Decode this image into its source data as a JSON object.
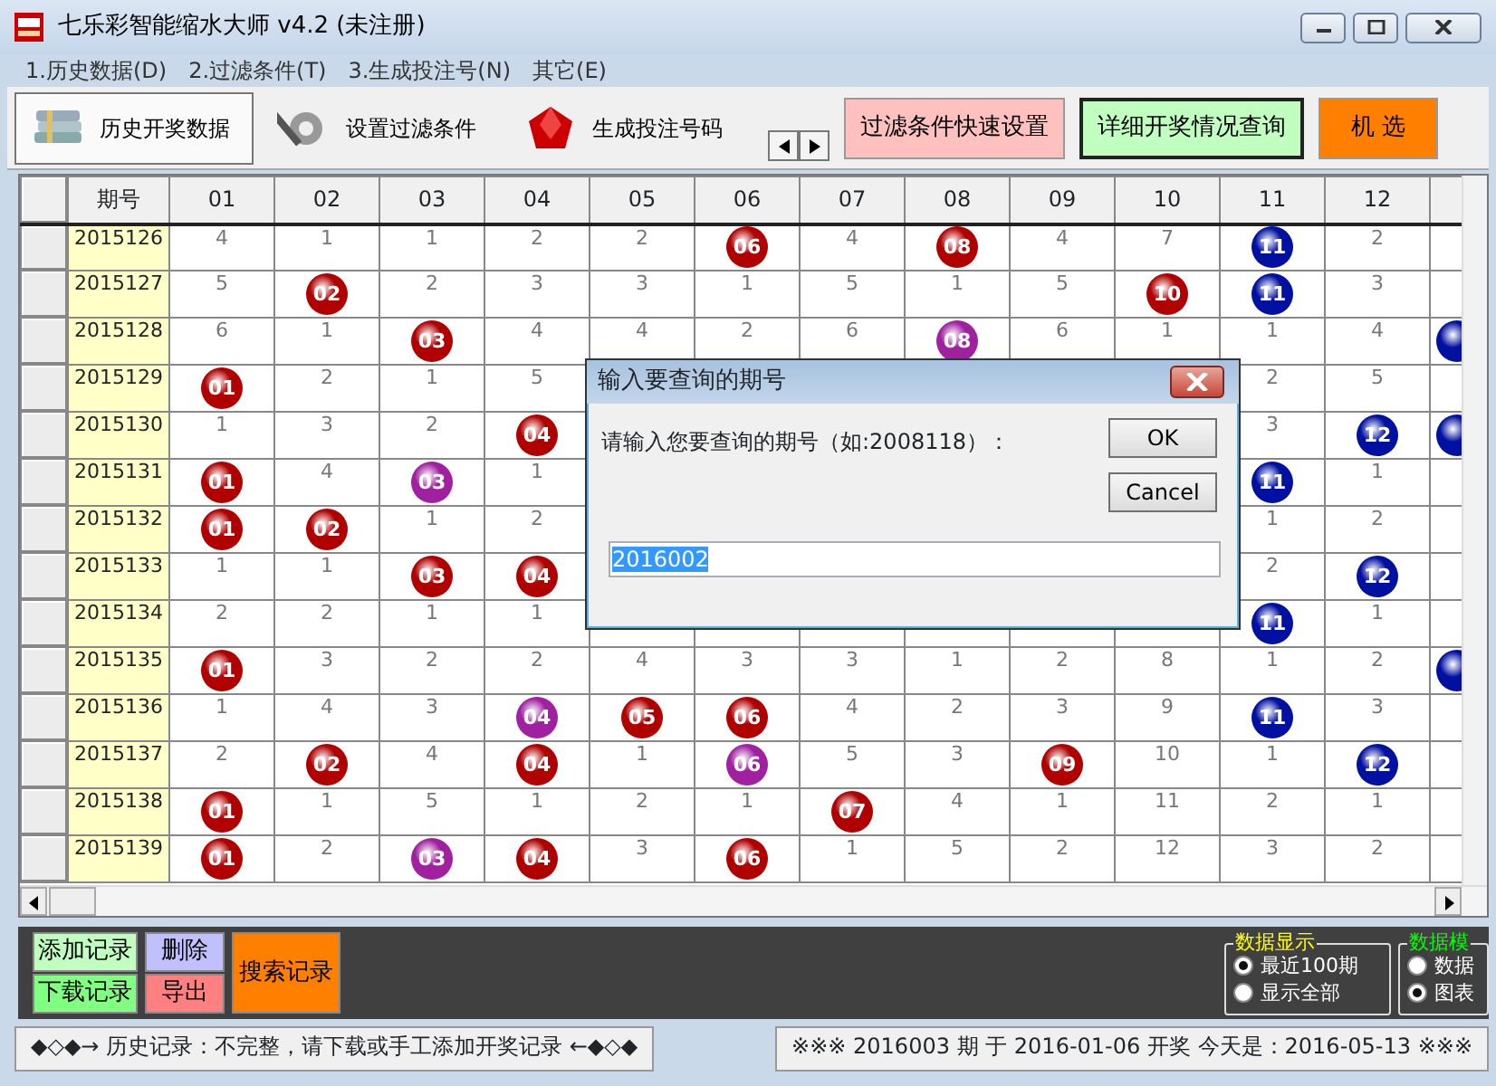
{
  "window": {
    "title": "七乐彩智能缩水大师 v4.2  (未注册)"
  },
  "menu": [
    {
      "label": "1.历史数据(D)"
    },
    {
      "label": "2.过滤条件(T)"
    },
    {
      "label": "3.生成投注号(N)"
    },
    {
      "label": "其它(E)"
    }
  ],
  "toolbar": {
    "tabs": [
      {
        "label": "历史开奖数据",
        "selected": true
      },
      {
        "label": "设置过滤条件",
        "selected": false
      },
      {
        "label": "生成投注号码",
        "selected": false
      }
    ],
    "buttons": [
      {
        "label": "过滤条件快速设置",
        "color": "#ffc0c0"
      },
      {
        "label": "详细开奖情况查询",
        "color": "#c0ffc0"
      },
      {
        "label": "机 选",
        "color": "#ff8000"
      }
    ]
  },
  "grid": {
    "columns": [
      "期号",
      "01",
      "02",
      "03",
      "04",
      "05",
      "06",
      "07",
      "08",
      "09",
      "10",
      "11",
      "12"
    ],
    "rows": [
      {
        "cells": [
          {
            "kind": "period",
            "text": "2015126"
          },
          {
            "kind": "miss",
            "text": "4"
          },
          {
            "kind": "miss",
            "text": "1"
          },
          {
            "kind": "miss",
            "text": "1"
          },
          {
            "kind": "miss",
            "text": "2"
          },
          {
            "kind": "miss",
            "text": "2"
          },
          {
            "kind": "ball",
            "text": "06",
            "color": "#b00000"
          },
          {
            "kind": "miss",
            "text": "4"
          },
          {
            "kind": "ball",
            "text": "08",
            "color": "#b00000"
          },
          {
            "kind": "miss",
            "text": "4"
          },
          {
            "kind": "miss",
            "text": "7"
          },
          {
            "kind": "ball",
            "text": "11",
            "color": "#0010a0"
          },
          {
            "kind": "miss",
            "text": "2"
          },
          null
        ]
      },
      {
        "cells": [
          {
            "kind": "period",
            "text": "2015127"
          },
          {
            "kind": "miss",
            "text": "5"
          },
          {
            "kind": "ball",
            "text": "02",
            "color": "#b00000"
          },
          {
            "kind": "miss",
            "text": "2"
          },
          {
            "kind": "miss",
            "text": "3"
          },
          {
            "kind": "miss",
            "text": "3"
          },
          {
            "kind": "miss",
            "text": "1"
          },
          {
            "kind": "miss",
            "text": "5"
          },
          {
            "kind": "miss",
            "text": "1"
          },
          {
            "kind": "miss",
            "text": "5"
          },
          {
            "kind": "ball",
            "text": "10",
            "color": "#b00000"
          },
          {
            "kind": "ball",
            "text": "11",
            "color": "#0010a0"
          },
          {
            "kind": "miss",
            "text": "3"
          },
          null
        ]
      },
      {
        "cells": [
          {
            "kind": "period",
            "text": "2015128"
          },
          {
            "kind": "miss",
            "text": "6"
          },
          {
            "kind": "miss",
            "text": "1"
          },
          {
            "kind": "ball",
            "text": "03",
            "color": "#b00000"
          },
          {
            "kind": "miss",
            "text": "4"
          },
          {
            "kind": "miss",
            "text": "4"
          },
          {
            "kind": "miss",
            "text": "2"
          },
          {
            "kind": "miss",
            "text": "6"
          },
          {
            "kind": "ball",
            "text": "08",
            "color": "#a020a0"
          },
          {
            "kind": "miss",
            "text": "6"
          },
          {
            "kind": "miss",
            "text": "1"
          },
          {
            "kind": "miss",
            "text": "1"
          },
          {
            "kind": "miss",
            "text": "4"
          },
          {
            "kind": "ball",
            "color": "#0010a0"
          }
        ]
      },
      {
        "cells": [
          {
            "kind": "period",
            "text": "2015129"
          },
          {
            "kind": "ball",
            "text": "01",
            "color": "#b00000"
          },
          {
            "kind": "miss",
            "text": "2"
          },
          {
            "kind": "miss",
            "text": "1"
          },
          {
            "kind": "miss",
            "text": "5"
          },
          null,
          null,
          null,
          null,
          null,
          null,
          {
            "kind": "miss",
            "text": "2"
          },
          {
            "kind": "miss",
            "text": "5"
          },
          null
        ]
      },
      {
        "cells": [
          {
            "kind": "period",
            "text": "2015130"
          },
          {
            "kind": "miss",
            "text": "1"
          },
          {
            "kind": "miss",
            "text": "3"
          },
          {
            "kind": "miss",
            "text": "2"
          },
          {
            "kind": "ball",
            "text": "04",
            "color": "#b00000"
          },
          null,
          null,
          null,
          null,
          null,
          null,
          {
            "kind": "miss",
            "text": "3"
          },
          {
            "kind": "ball",
            "text": "12",
            "color": "#0010a0"
          },
          {
            "kind": "ball",
            "color": "#0010a0"
          }
        ]
      },
      {
        "cells": [
          {
            "kind": "period",
            "text": "2015131"
          },
          {
            "kind": "ball",
            "text": "01",
            "color": "#b00000"
          },
          {
            "kind": "miss",
            "text": "4"
          },
          {
            "kind": "ball",
            "text": "03",
            "color": "#a020a0"
          },
          {
            "kind": "miss",
            "text": "1"
          },
          null,
          null,
          null,
          null,
          null,
          null,
          {
            "kind": "ball",
            "text": "11",
            "color": "#0010a0"
          },
          {
            "kind": "miss",
            "text": "1"
          },
          null
        ]
      },
      {
        "cells": [
          {
            "kind": "period",
            "text": "2015132"
          },
          {
            "kind": "ball",
            "text": "01",
            "color": "#b00000"
          },
          {
            "kind": "ball",
            "text": "02",
            "color": "#b00000"
          },
          {
            "kind": "miss",
            "text": "1"
          },
          {
            "kind": "miss",
            "text": "2"
          },
          null,
          null,
          null,
          null,
          null,
          null,
          {
            "kind": "miss",
            "text": "1"
          },
          {
            "kind": "miss",
            "text": "2"
          },
          null
        ]
      },
      {
        "cells": [
          {
            "kind": "period",
            "text": "2015133"
          },
          {
            "kind": "miss",
            "text": "1"
          },
          {
            "kind": "miss",
            "text": "1"
          },
          {
            "kind": "ball",
            "text": "03",
            "color": "#b00000"
          },
          {
            "kind": "ball",
            "text": "04",
            "color": "#b00000"
          },
          null,
          null,
          null,
          null,
          null,
          null,
          {
            "kind": "miss",
            "text": "2"
          },
          {
            "kind": "ball",
            "text": "12",
            "color": "#0010a0"
          },
          null
        ]
      },
      {
        "cells": [
          {
            "kind": "period",
            "text": "2015134"
          },
          {
            "kind": "miss",
            "text": "2"
          },
          {
            "kind": "miss",
            "text": "2"
          },
          {
            "kind": "miss",
            "text": "1"
          },
          {
            "kind": "miss",
            "text": "1"
          },
          null,
          null,
          null,
          null,
          null,
          null,
          {
            "kind": "ball",
            "text": "11",
            "color": "#0010a0"
          },
          {
            "kind": "miss",
            "text": "1"
          },
          null
        ]
      },
      {
        "cells": [
          {
            "kind": "period",
            "text": "2015135"
          },
          {
            "kind": "ball",
            "text": "01",
            "color": "#b00000"
          },
          {
            "kind": "miss",
            "text": "3"
          },
          {
            "kind": "miss",
            "text": "2"
          },
          {
            "kind": "miss",
            "text": "2"
          },
          {
            "kind": "miss",
            "text": "4"
          },
          {
            "kind": "miss",
            "text": "3"
          },
          {
            "kind": "miss",
            "text": "3"
          },
          {
            "kind": "miss",
            "text": "1"
          },
          {
            "kind": "miss",
            "text": "2"
          },
          {
            "kind": "miss",
            "text": "8"
          },
          {
            "kind": "miss",
            "text": "1"
          },
          {
            "kind": "miss",
            "text": "2"
          },
          {
            "kind": "ball",
            "color": "#0010a0"
          }
        ]
      },
      {
        "cells": [
          {
            "kind": "period",
            "text": "2015136"
          },
          {
            "kind": "miss",
            "text": "1"
          },
          {
            "kind": "miss",
            "text": "4"
          },
          {
            "kind": "miss",
            "text": "3"
          },
          {
            "kind": "ball",
            "text": "04",
            "color": "#a020a0"
          },
          {
            "kind": "ball",
            "text": "05",
            "color": "#b00000"
          },
          {
            "kind": "ball",
            "text": "06",
            "color": "#b00000"
          },
          {
            "kind": "miss",
            "text": "4"
          },
          {
            "kind": "miss",
            "text": "2"
          },
          {
            "kind": "miss",
            "text": "3"
          },
          {
            "kind": "miss",
            "text": "9"
          },
          {
            "kind": "ball",
            "text": "11",
            "color": "#0010a0"
          },
          {
            "kind": "miss",
            "text": "3"
          },
          null
        ]
      },
      {
        "cells": [
          {
            "kind": "period",
            "text": "2015137"
          },
          {
            "kind": "miss",
            "text": "2"
          },
          {
            "kind": "ball",
            "text": "02",
            "color": "#b00000"
          },
          {
            "kind": "miss",
            "text": "4"
          },
          {
            "kind": "ball",
            "text": "04",
            "color": "#b00000"
          },
          {
            "kind": "miss",
            "text": "1"
          },
          {
            "kind": "ball",
            "text": "06",
            "color": "#a020a0"
          },
          {
            "kind": "miss",
            "text": "5"
          },
          {
            "kind": "miss",
            "text": "3"
          },
          {
            "kind": "ball",
            "text": "09",
            "color": "#b00000"
          },
          {
            "kind": "miss",
            "text": "10"
          },
          {
            "kind": "miss",
            "text": "1"
          },
          {
            "kind": "ball",
            "text": "12",
            "color": "#0010a0"
          },
          null
        ]
      },
      {
        "cells": [
          {
            "kind": "period",
            "text": "2015138"
          },
          {
            "kind": "ball",
            "text": "01",
            "color": "#b00000"
          },
          {
            "kind": "miss",
            "text": "1"
          },
          {
            "kind": "miss",
            "text": "5"
          },
          {
            "kind": "miss",
            "text": "1"
          },
          {
            "kind": "miss",
            "text": "2"
          },
          {
            "kind": "miss",
            "text": "1"
          },
          {
            "kind": "ball",
            "text": "07",
            "color": "#b00000"
          },
          {
            "kind": "miss",
            "text": "4"
          },
          {
            "kind": "miss",
            "text": "1"
          },
          {
            "kind": "miss",
            "text": "11"
          },
          {
            "kind": "miss",
            "text": "2"
          },
          {
            "kind": "miss",
            "text": "1"
          },
          null
        ]
      },
      {
        "cells": [
          {
            "kind": "period",
            "text": "2015139"
          },
          {
            "kind": "ball",
            "text": "01",
            "color": "#b00000"
          },
          {
            "kind": "miss",
            "text": "2"
          },
          {
            "kind": "ball",
            "text": "03",
            "color": "#a020a0"
          },
          {
            "kind": "ball",
            "text": "04",
            "color": "#b00000"
          },
          {
            "kind": "miss",
            "text": "3"
          },
          {
            "kind": "ball",
            "text": "06",
            "color": "#b00000"
          },
          {
            "kind": "miss",
            "text": "1"
          },
          {
            "kind": "miss",
            "text": "5"
          },
          {
            "kind": "miss",
            "text": "2"
          },
          {
            "kind": "miss",
            "text": "12"
          },
          {
            "kind": "miss",
            "text": "3"
          },
          {
            "kind": "miss",
            "text": "2"
          },
          null
        ]
      }
    ]
  },
  "dialog": {
    "title": "输入要查询的期号",
    "prompt": "请输入您要查询的期号（如:2008118）：",
    "value": "2016002",
    "buttons": [
      "OK",
      "Cancel"
    ]
  },
  "actions": [
    {
      "label": "添加记录",
      "color": "#c0ffc0"
    },
    {
      "label": "删除",
      "color": "#c0c0ff"
    },
    {
      "label": "下载记录",
      "color": "#80ff80"
    },
    {
      "label": "导出",
      "color": "#ff8080"
    },
    {
      "label": "搜索记录",
      "color": "#ff8000"
    }
  ],
  "display_group": {
    "title": "数据显示",
    "color": "#ffff00",
    "options": [
      {
        "label": "最近100期",
        "selected": true
      },
      {
        "label": "显示全部",
        "selected": false
      }
    ]
  },
  "mode_group": {
    "title": "数据模",
    "color": "#00ff00",
    "options": [
      {
        "label": "数据",
        "selected": false
      },
      {
        "label": "图表",
        "selected": true
      }
    ]
  },
  "status_bar": {
    "left": "◆◇◆→ 历史记录：不完整，请下载或手工添加开奖记录 ←◆◇◆",
    "right": "※※※  2016003 期 于 2016-01-06 开奖     今天是：2016-05-13 ※※※"
  }
}
